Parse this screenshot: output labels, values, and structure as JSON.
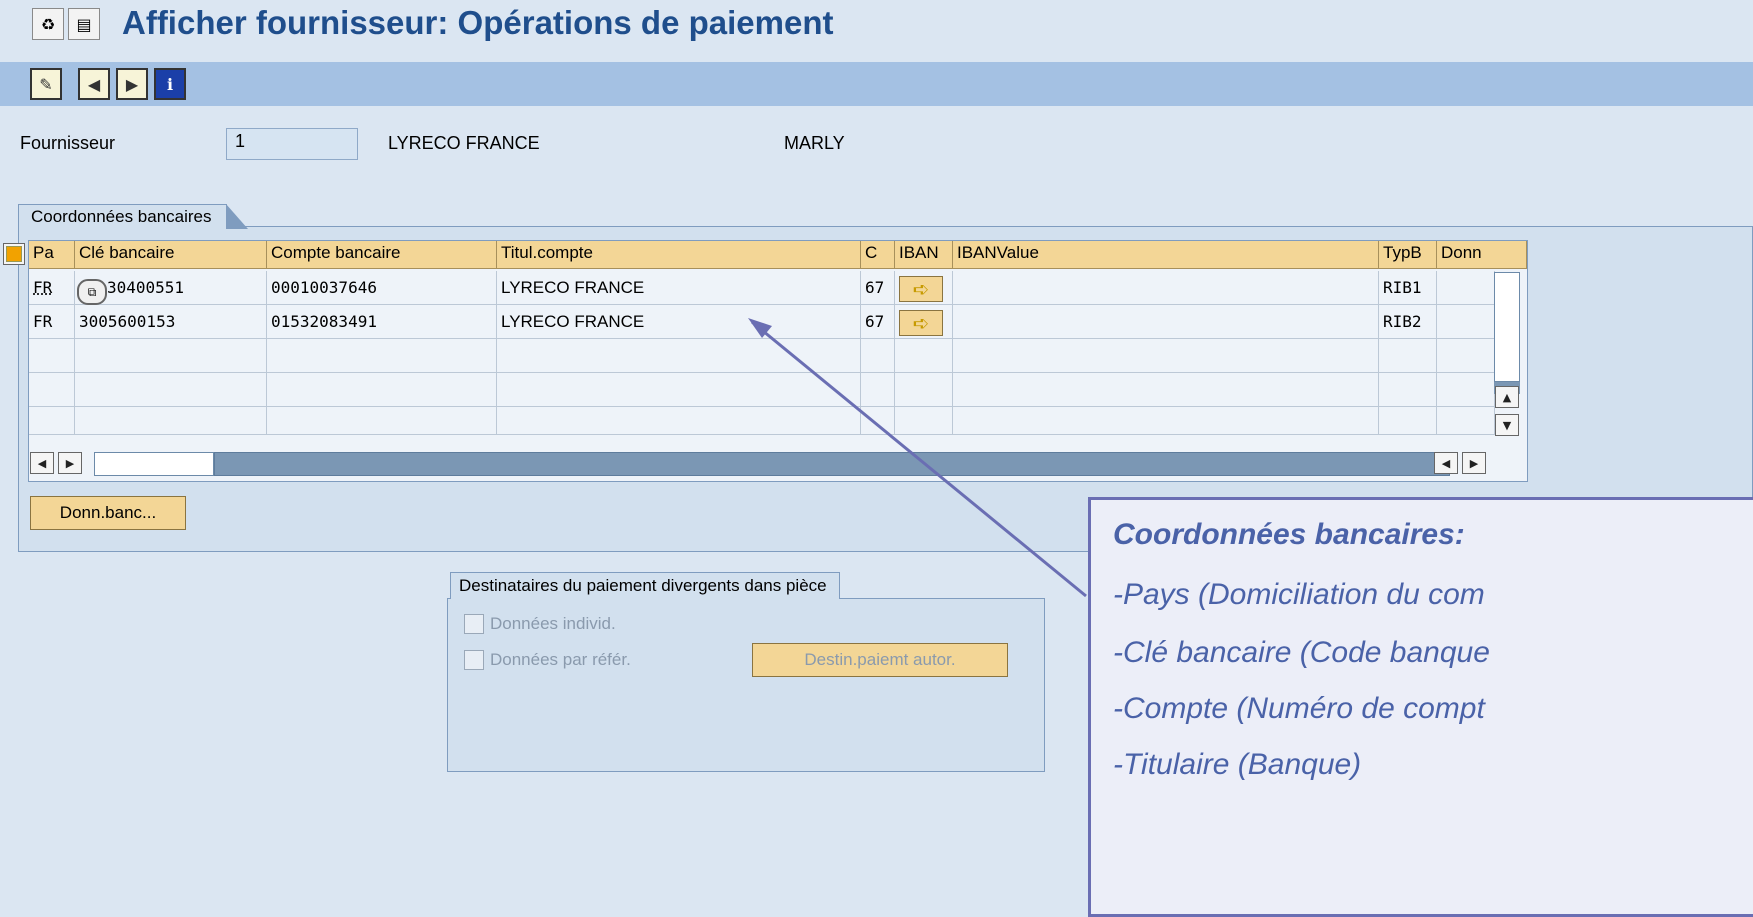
{
  "title": "Afficher fournisseur: Opérations de paiement",
  "header": {
    "fournisseur_label": "Fournisseur",
    "fournisseur_value": "1",
    "vendor_name": "LYRECO FRANCE",
    "vendor_city": "MARLY"
  },
  "bank_group": {
    "tab_label": "Coordonnées bancaires",
    "columns": [
      "Pa",
      "Clé bancaire",
      "Compte bancaire",
      "Titul.compte",
      "C",
      "IBAN",
      "IBANValue",
      "TypB",
      "Donn"
    ],
    "rows": [
      {
        "pays": "FR",
        "cle": "30400551",
        "compte": "00010037646",
        "titulaire": "LYRECO FRANCE",
        "c": "67",
        "iban_value": "",
        "typb": "RIB1",
        "donn": ""
      },
      {
        "pays": "FR",
        "cle": "3005600153",
        "compte": "01532083491",
        "titulaire": "LYRECO FRANCE",
        "c": "67",
        "iban_value": "",
        "typb": "RIB2",
        "donn": ""
      }
    ],
    "donn_banc_button": "Donn.banc..."
  },
  "payee_group": {
    "tab_label": "Destinataires du paiement divergents dans pièce",
    "chk_individ": "Données individ.",
    "chk_refer": "Données par référ.",
    "destin_button": "Destin.paiemt autor."
  },
  "callout": {
    "title": "Coordonnées bancaires:",
    "items": [
      "-Pays (Domiciliation du com",
      "-Clé bancaire (Code banque",
      "-Compte (Numéro de compt",
      "-Titulaire (Banque)"
    ]
  },
  "colors": {
    "accent": "#1f4e8c",
    "toolbar": "#a4c1e3",
    "header_cell": "#f3d696",
    "callout_text": "#4a62a8"
  }
}
